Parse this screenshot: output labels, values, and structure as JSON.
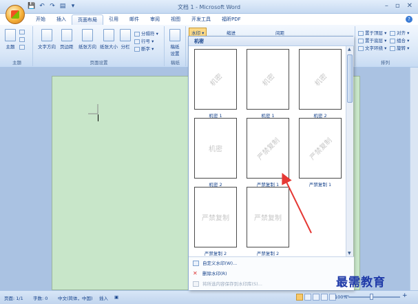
{
  "window": {
    "title": "文档 1 - Microsoft Word"
  },
  "qat": {
    "save": "💾",
    "undo": "↶",
    "redo": "↷",
    "print": "▤",
    "more": "▾"
  },
  "tabs": [
    "开始",
    "插入",
    "页面布局",
    "引用",
    "邮件",
    "审阅",
    "视图",
    "开发工具",
    "福昕PDF"
  ],
  "active_tab": "页面布局",
  "ribbon": {
    "theme_group": {
      "label": "主题",
      "buttons": [
        "主题"
      ]
    },
    "page_setup": {
      "label": "页面设置",
      "buttons": [
        "文字方向",
        "页边距",
        "纸张方向",
        "纸张大小",
        "分栏"
      ],
      "small": [
        "分隔符 ▾",
        "行号 ▾",
        "断字 ▾"
      ]
    },
    "draft": {
      "label": "稿纸",
      "button": "稿纸\n设置"
    },
    "watermark_button": "水印 ▾",
    "page_color": "页面颜色",
    "page_border": "页面边框",
    "indent_label": "缩进",
    "spacing_label": "间距",
    "arrange": {
      "label": "排列",
      "items": [
        "置于顶层 ▾",
        "置于底层 ▾",
        "文字环绕 ▾",
        "对齐 ▾",
        "组合 ▾",
        "旋转 ▾"
      ]
    }
  },
  "gallery": {
    "header": "机密",
    "items": [
      {
        "caption": "机密 1",
        "watermark": "机密",
        "diagonal": true
      },
      {
        "caption": "机密 1",
        "watermark": "机密",
        "diagonal": true
      },
      {
        "caption": "机密 2",
        "watermark": "机密",
        "diagonal": true
      },
      {
        "caption": "机密 2",
        "watermark": "机密",
        "diagonal": false
      },
      {
        "caption": "严禁复制 1",
        "watermark": "严禁复制",
        "diagonal": true
      },
      {
        "caption": "严禁复制 1",
        "watermark": "严禁复制",
        "diagonal": true
      },
      {
        "caption": "严禁复制 2",
        "watermark": "严禁复制",
        "diagonal": false
      },
      {
        "caption": "严禁复制 2",
        "watermark": "严禁复制",
        "diagonal": false
      }
    ],
    "menu": [
      {
        "label": "自定义水印(W)...",
        "enabled": true
      },
      {
        "label": "删除水印(R)",
        "enabled": true
      },
      {
        "label": "将所选内容保存到水印库(S)...",
        "enabled": false
      }
    ]
  },
  "status": {
    "page": "页面: 1/1",
    "words": "字数: 0",
    "language": "中文(简体，中国)",
    "insert": "插入",
    "zoom": "100%",
    "zoom_minus": "−",
    "zoom_plus": "+"
  },
  "brand": "最需教育",
  "colors": {
    "accent": "#15428b",
    "page_bg": "#c8e6c9",
    "arrow": "#e53935"
  }
}
